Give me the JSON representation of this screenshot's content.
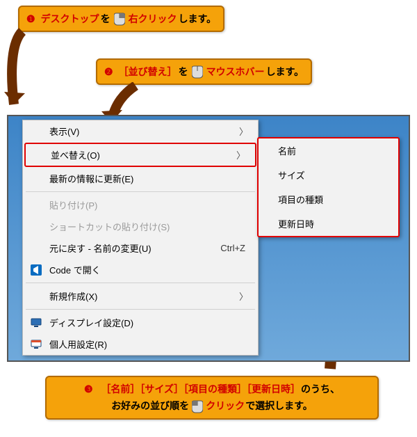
{
  "callouts": {
    "c1": {
      "idx": "❶",
      "t1": "デスクトップ",
      "t2": "を",
      "t3": "右クリック",
      "t4": "します。"
    },
    "c2": {
      "idx": "❷",
      "t1": "［並び替え］",
      "t2": "を",
      "t3": "マウスホバー",
      "t4": "します。"
    },
    "c3": {
      "idx": "❸",
      "line1a": "［名前］［サイズ］［項目の種類］［更新日時］",
      "line1b": "のうち、",
      "line2a": "お好みの並び順を",
      "line2c": "クリック",
      "line2d": "で選択します。"
    }
  },
  "ctx": {
    "view": {
      "label": "表示(V)",
      "hasSub": true
    },
    "sort": {
      "label": "並べ替え(O)",
      "hasSub": true
    },
    "refresh": {
      "label": "最新の情報に更新(E)"
    },
    "paste": {
      "label": "貼り付け(P)"
    },
    "pasteShort": {
      "label": "ショートカットの貼り付け(S)"
    },
    "undo": {
      "label": "元に戻す - 名前の変更(U)",
      "shortcut": "Ctrl+Z"
    },
    "code": {
      "label": "Code で開く"
    },
    "new": {
      "label": "新規作成(X)",
      "hasSub": true
    },
    "display": {
      "label": "ディスプレイ設定(D)"
    },
    "personal": {
      "label": "個人用設定(R)"
    }
  },
  "submenu": {
    "name": "名前",
    "size": "サイズ",
    "type": "項目の種類",
    "date": "更新日時"
  },
  "glyphs": {
    "chevron": "〉"
  }
}
